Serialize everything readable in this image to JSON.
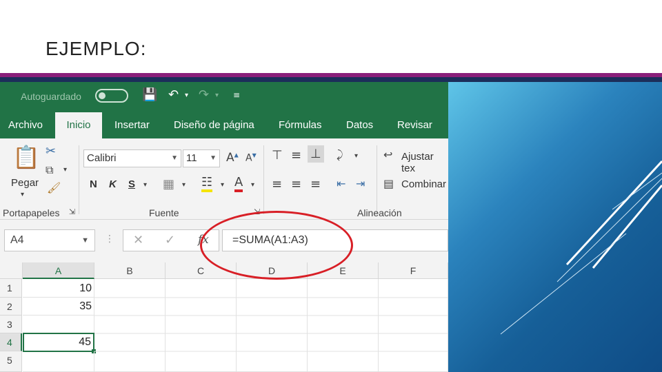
{
  "slide": {
    "title": "EJEMPLO:"
  },
  "excel": {
    "titlebar": {
      "autosave_label": "Autoguardado"
    },
    "tabs": [
      "Archivo",
      "Inicio",
      "Insertar",
      "Diseño de página",
      "Fórmulas",
      "Datos",
      "Revisar"
    ],
    "active_tab": "Inicio",
    "ribbon": {
      "paste_label": "Pegar",
      "clipboard_group": "Portapapeles",
      "font_name": "Calibri",
      "font_size": "11",
      "bold": "N",
      "italic": "K",
      "underline": "S",
      "font_group": "Fuente",
      "wrap_text": "Ajustar tex",
      "merge": "Combinar",
      "alignment_group": "Alineación"
    },
    "name_box": "A4",
    "formula": "=SUMA(A1:A3)",
    "columns": [
      "A",
      "B",
      "C",
      "D",
      "E",
      "F"
    ],
    "rows": [
      {
        "num": "1",
        "a": "10"
      },
      {
        "num": "2",
        "a": "35"
      },
      {
        "num": "3",
        "a": ""
      },
      {
        "num": "4",
        "a": "45"
      },
      {
        "num": "5",
        "a": ""
      }
    ]
  },
  "colors": {
    "excel_green": "#217346",
    "highlight_ellipse": "#d81f26",
    "accent_bar": "#8a1f7a",
    "panel_blue": "#165f98"
  }
}
